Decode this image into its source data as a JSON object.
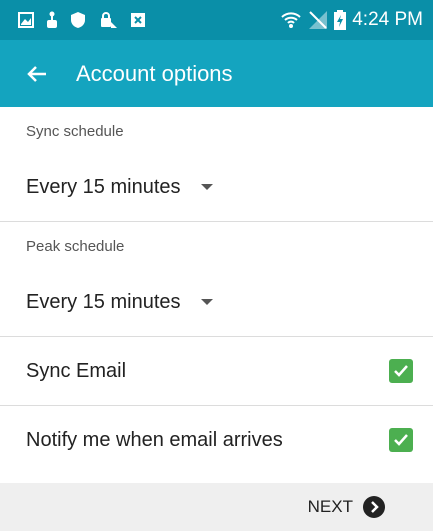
{
  "status_bar": {
    "time": "4:24 PM",
    "left_icons": [
      "gallery-icon",
      "usb-icon",
      "shield-icon",
      "vpn-key-icon",
      "no-sim-icon"
    ],
    "right_icons": [
      "wifi-icon",
      "signal-icon",
      "battery-icon"
    ]
  },
  "app_bar": {
    "title": "Account options",
    "back_icon": "arrow-back-icon",
    "background": "#14a4bf"
  },
  "sync_schedule": {
    "label": "Sync schedule",
    "value": "Every 15 minutes"
  },
  "peak_schedule": {
    "label": "Peak schedule",
    "value": "Every 15 minutes"
  },
  "sync_email": {
    "label": "Sync Email",
    "checked": true
  },
  "notify_email": {
    "label": "Notify me when email arrives",
    "checked": true
  },
  "footer": {
    "next_label": "NEXT",
    "next_icon": "arrow-circle-right-icon"
  },
  "colors": {
    "status_bar": "#0a8fa8",
    "app_bar": "#14a4bf",
    "checkbox": "#4caf50",
    "footer": "#efefef"
  }
}
